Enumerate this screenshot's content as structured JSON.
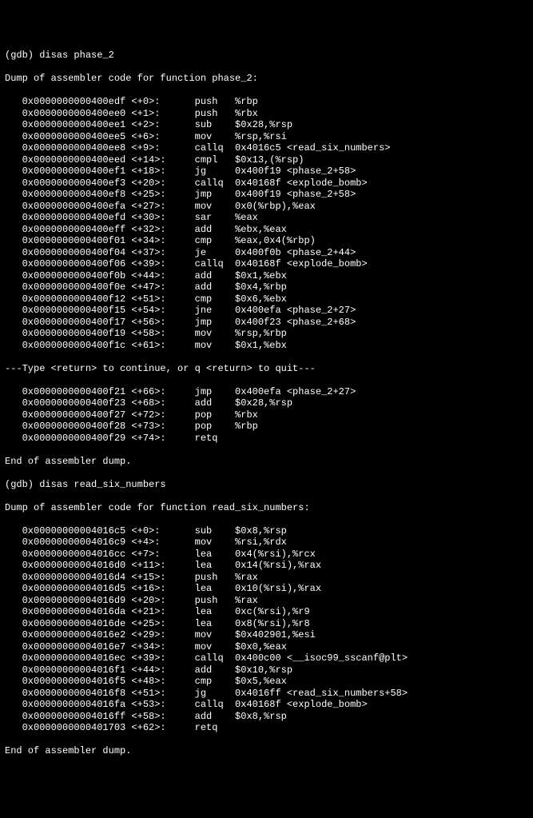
{
  "top_prompt": "(gdb) disas phase_2",
  "header1": "Dump of assembler code for function phase_2:",
  "phase_2": [
    {
      "addr": "0x0000000000400edf",
      "ofs": "<+0>:",
      "mn": "push",
      "op": "%rbp"
    },
    {
      "addr": "0x0000000000400ee0",
      "ofs": "<+1>:",
      "mn": "push",
      "op": "%rbx"
    },
    {
      "addr": "0x0000000000400ee1",
      "ofs": "<+2>:",
      "mn": "sub",
      "op": "$0x28,%rsp"
    },
    {
      "addr": "0x0000000000400ee5",
      "ofs": "<+6>:",
      "mn": "mov",
      "op": "%rsp,%rsi"
    },
    {
      "addr": "0x0000000000400ee8",
      "ofs": "<+9>:",
      "mn": "callq",
      "op": "0x4016c5 <read_six_numbers>"
    },
    {
      "addr": "0x0000000000400eed",
      "ofs": "<+14>:",
      "mn": "cmpl",
      "op": "$0x13,(%rsp)"
    },
    {
      "addr": "0x0000000000400ef1",
      "ofs": "<+18>:",
      "mn": "jg",
      "op": "0x400f19 <phase_2+58>"
    },
    {
      "addr": "0x0000000000400ef3",
      "ofs": "<+20>:",
      "mn": "callq",
      "op": "0x40168f <explode_bomb>"
    },
    {
      "addr": "0x0000000000400ef8",
      "ofs": "<+25>:",
      "mn": "jmp",
      "op": "0x400f19 <phase_2+58>"
    },
    {
      "addr": "0x0000000000400efa",
      "ofs": "<+27>:",
      "mn": "mov",
      "op": "0x0(%rbp),%eax"
    },
    {
      "addr": "0x0000000000400efd",
      "ofs": "<+30>:",
      "mn": "sar",
      "op": "%eax"
    },
    {
      "addr": "0x0000000000400eff",
      "ofs": "<+32>:",
      "mn": "add",
      "op": "%ebx,%eax"
    },
    {
      "addr": "0x0000000000400f01",
      "ofs": "<+34>:",
      "mn": "cmp",
      "op": "%eax,0x4(%rbp)"
    },
    {
      "addr": "0x0000000000400f04",
      "ofs": "<+37>:",
      "mn": "je",
      "op": "0x400f0b <phase_2+44>"
    },
    {
      "addr": "0x0000000000400f06",
      "ofs": "<+39>:",
      "mn": "callq",
      "op": "0x40168f <explode_bomb>"
    },
    {
      "addr": "0x0000000000400f0b",
      "ofs": "<+44>:",
      "mn": "add",
      "op": "$0x1,%ebx"
    },
    {
      "addr": "0x0000000000400f0e",
      "ofs": "<+47>:",
      "mn": "add",
      "op": "$0x4,%rbp"
    },
    {
      "addr": "0x0000000000400f12",
      "ofs": "<+51>:",
      "mn": "cmp",
      "op": "$0x6,%ebx"
    },
    {
      "addr": "0x0000000000400f15",
      "ofs": "<+54>:",
      "mn": "jne",
      "op": "0x400efa <phase_2+27>"
    },
    {
      "addr": "0x0000000000400f17",
      "ofs": "<+56>:",
      "mn": "jmp",
      "op": "0x400f23 <phase_2+68>"
    },
    {
      "addr": "0x0000000000400f19",
      "ofs": "<+58>:",
      "mn": "mov",
      "op": "%rsp,%rbp"
    },
    {
      "addr": "0x0000000000400f1c",
      "ofs": "<+61>:",
      "mn": "mov",
      "op": "$0x1,%ebx"
    }
  ],
  "pager": "---Type <return> to continue, or q <return> to quit---",
  "phase_2b": [
    {
      "addr": "0x0000000000400f21",
      "ofs": "<+66>:",
      "mn": "jmp",
      "op": "0x400efa <phase_2+27>"
    },
    {
      "addr": "0x0000000000400f23",
      "ofs": "<+68>:",
      "mn": "add",
      "op": "$0x28,%rsp"
    },
    {
      "addr": "0x0000000000400f27",
      "ofs": "<+72>:",
      "mn": "pop",
      "op": "%rbx"
    },
    {
      "addr": "0x0000000000400f28",
      "ofs": "<+73>:",
      "mn": "pop",
      "op": "%rbp"
    },
    {
      "addr": "0x0000000000400f29",
      "ofs": "<+74>:",
      "mn": "retq",
      "op": ""
    }
  ],
  "footer1": "End of assembler dump.",
  "prompt2": "(gdb) disas read_six_numbers",
  "header2": "Dump of assembler code for function read_six_numbers:",
  "rsn": [
    {
      "addr": "0x00000000004016c5",
      "ofs": "<+0>:",
      "mn": "sub",
      "op": "$0x8,%rsp"
    },
    {
      "addr": "0x00000000004016c9",
      "ofs": "<+4>:",
      "mn": "mov",
      "op": "%rsi,%rdx"
    },
    {
      "addr": "0x00000000004016cc",
      "ofs": "<+7>:",
      "mn": "lea",
      "op": "0x4(%rsi),%rcx"
    },
    {
      "addr": "0x00000000004016d0",
      "ofs": "<+11>:",
      "mn": "lea",
      "op": "0x14(%rsi),%rax"
    },
    {
      "addr": "0x00000000004016d4",
      "ofs": "<+15>:",
      "mn": "push",
      "op": "%rax"
    },
    {
      "addr": "0x00000000004016d5",
      "ofs": "<+16>:",
      "mn": "lea",
      "op": "0x10(%rsi),%rax"
    },
    {
      "addr": "0x00000000004016d9",
      "ofs": "<+20>:",
      "mn": "push",
      "op": "%rax"
    },
    {
      "addr": "0x00000000004016da",
      "ofs": "<+21>:",
      "mn": "lea",
      "op": "0xc(%rsi),%r9"
    },
    {
      "addr": "0x00000000004016de",
      "ofs": "<+25>:",
      "mn": "lea",
      "op": "0x8(%rsi),%r8"
    },
    {
      "addr": "0x00000000004016e2",
      "ofs": "<+29>:",
      "mn": "mov",
      "op": "$0x402901,%esi"
    },
    {
      "addr": "0x00000000004016e7",
      "ofs": "<+34>:",
      "mn": "mov",
      "op": "$0x0,%eax"
    },
    {
      "addr": "0x00000000004016ec",
      "ofs": "<+39>:",
      "mn": "callq",
      "op": "0x400c00 <__isoc99_sscanf@plt>"
    },
    {
      "addr": "0x00000000004016f1",
      "ofs": "<+44>:",
      "mn": "add",
      "op": "$0x10,%rsp"
    },
    {
      "addr": "0x00000000004016f5",
      "ofs": "<+48>:",
      "mn": "cmp",
      "op": "$0x5,%eax"
    },
    {
      "addr": "0x00000000004016f8",
      "ofs": "<+51>:",
      "mn": "jg",
      "op": "0x4016ff <read_six_numbers+58>"
    },
    {
      "addr": "0x00000000004016fa",
      "ofs": "<+53>:",
      "mn": "callq",
      "op": "0x40168f <explode_bomb>"
    },
    {
      "addr": "0x00000000004016ff",
      "ofs": "<+58>:",
      "mn": "add",
      "op": "$0x8,%rsp"
    },
    {
      "addr": "0x0000000000401703",
      "ofs": "<+62>:",
      "mn": "retq",
      "op": ""
    }
  ],
  "footer2": "End of assembler dump."
}
